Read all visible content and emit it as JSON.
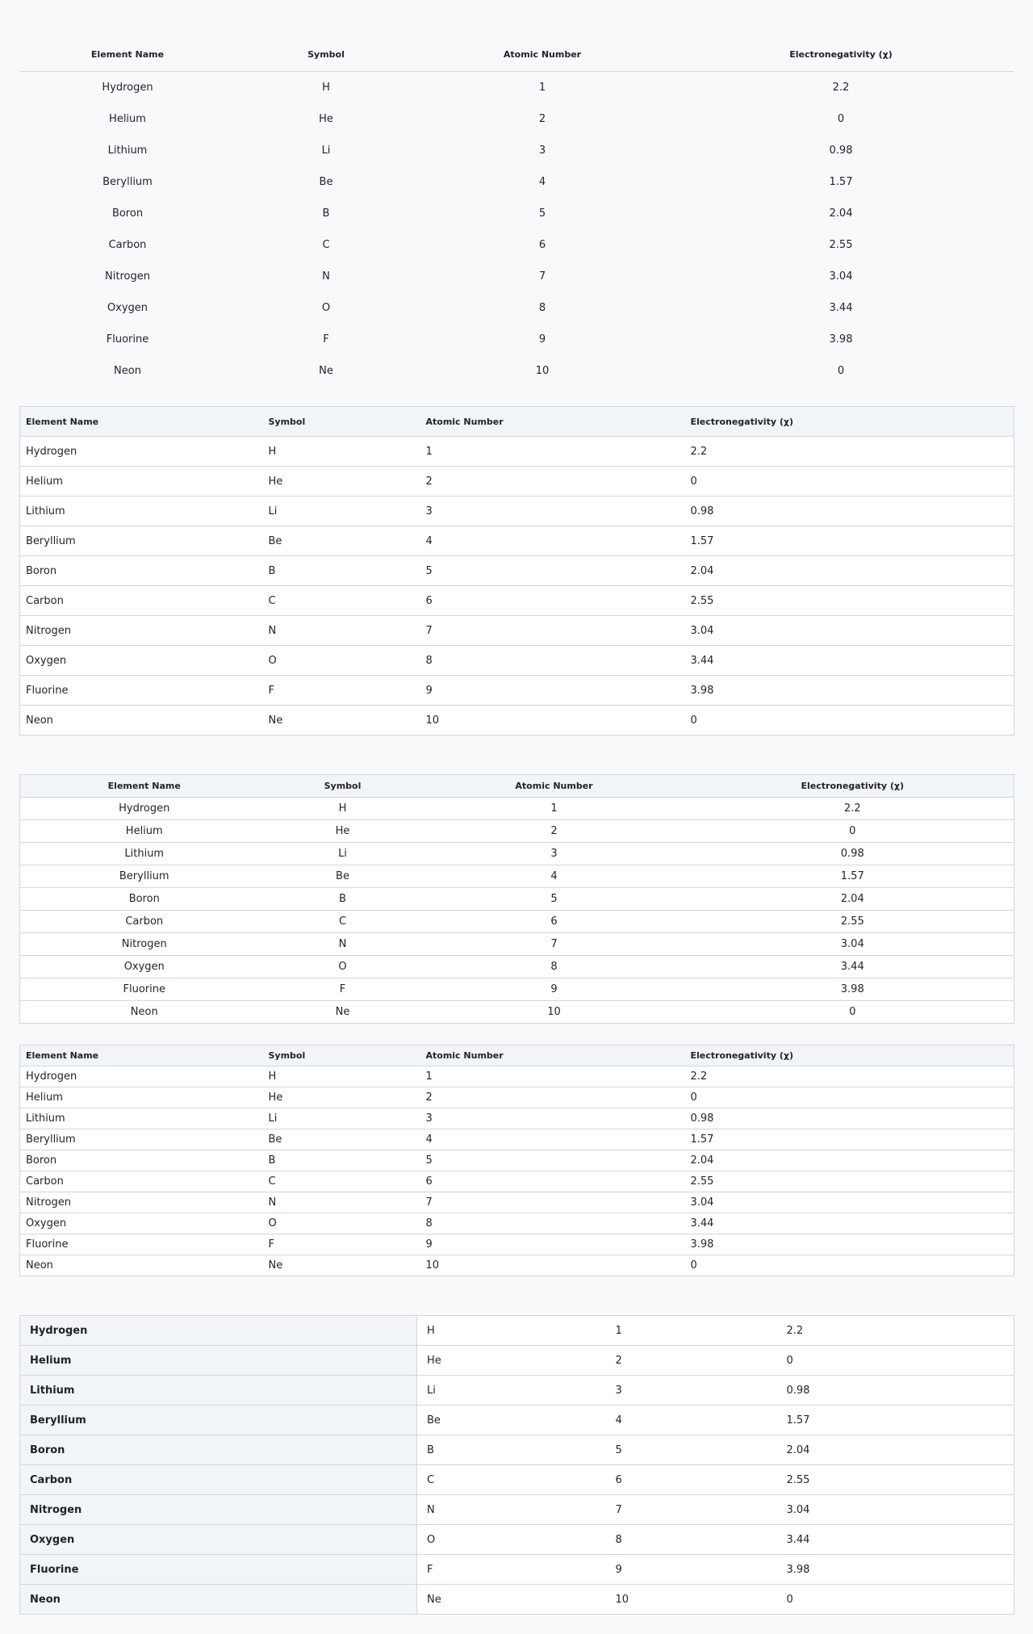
{
  "headers": [
    "Element Name",
    "Symbol",
    "Atomic Number",
    "Electronegativity (χ)"
  ],
  "rows": [
    [
      "Hydrogen",
      "H",
      "1",
      "2.2"
    ],
    [
      "Helium",
      "He",
      "2",
      "0"
    ],
    [
      "Lithium",
      "Li",
      "3",
      "0.98"
    ],
    [
      "Beryllium",
      "Be",
      "4",
      "1.57"
    ],
    [
      "Boron",
      "B",
      "5",
      "2.04"
    ],
    [
      "Carbon",
      "C",
      "6",
      "2.55"
    ],
    [
      "Nitrogen",
      "N",
      "7",
      "3.04"
    ],
    [
      "Oxygen",
      "O",
      "8",
      "3.44"
    ],
    [
      "Fluorine",
      "F",
      "9",
      "3.98"
    ],
    [
      "Neon",
      "Ne",
      "10",
      "0"
    ]
  ],
  "colors": {
    "background": "#f8f9fa",
    "header_fill": "#f1f5f8",
    "border": "#d0d7de",
    "text": "#1f2328"
  }
}
